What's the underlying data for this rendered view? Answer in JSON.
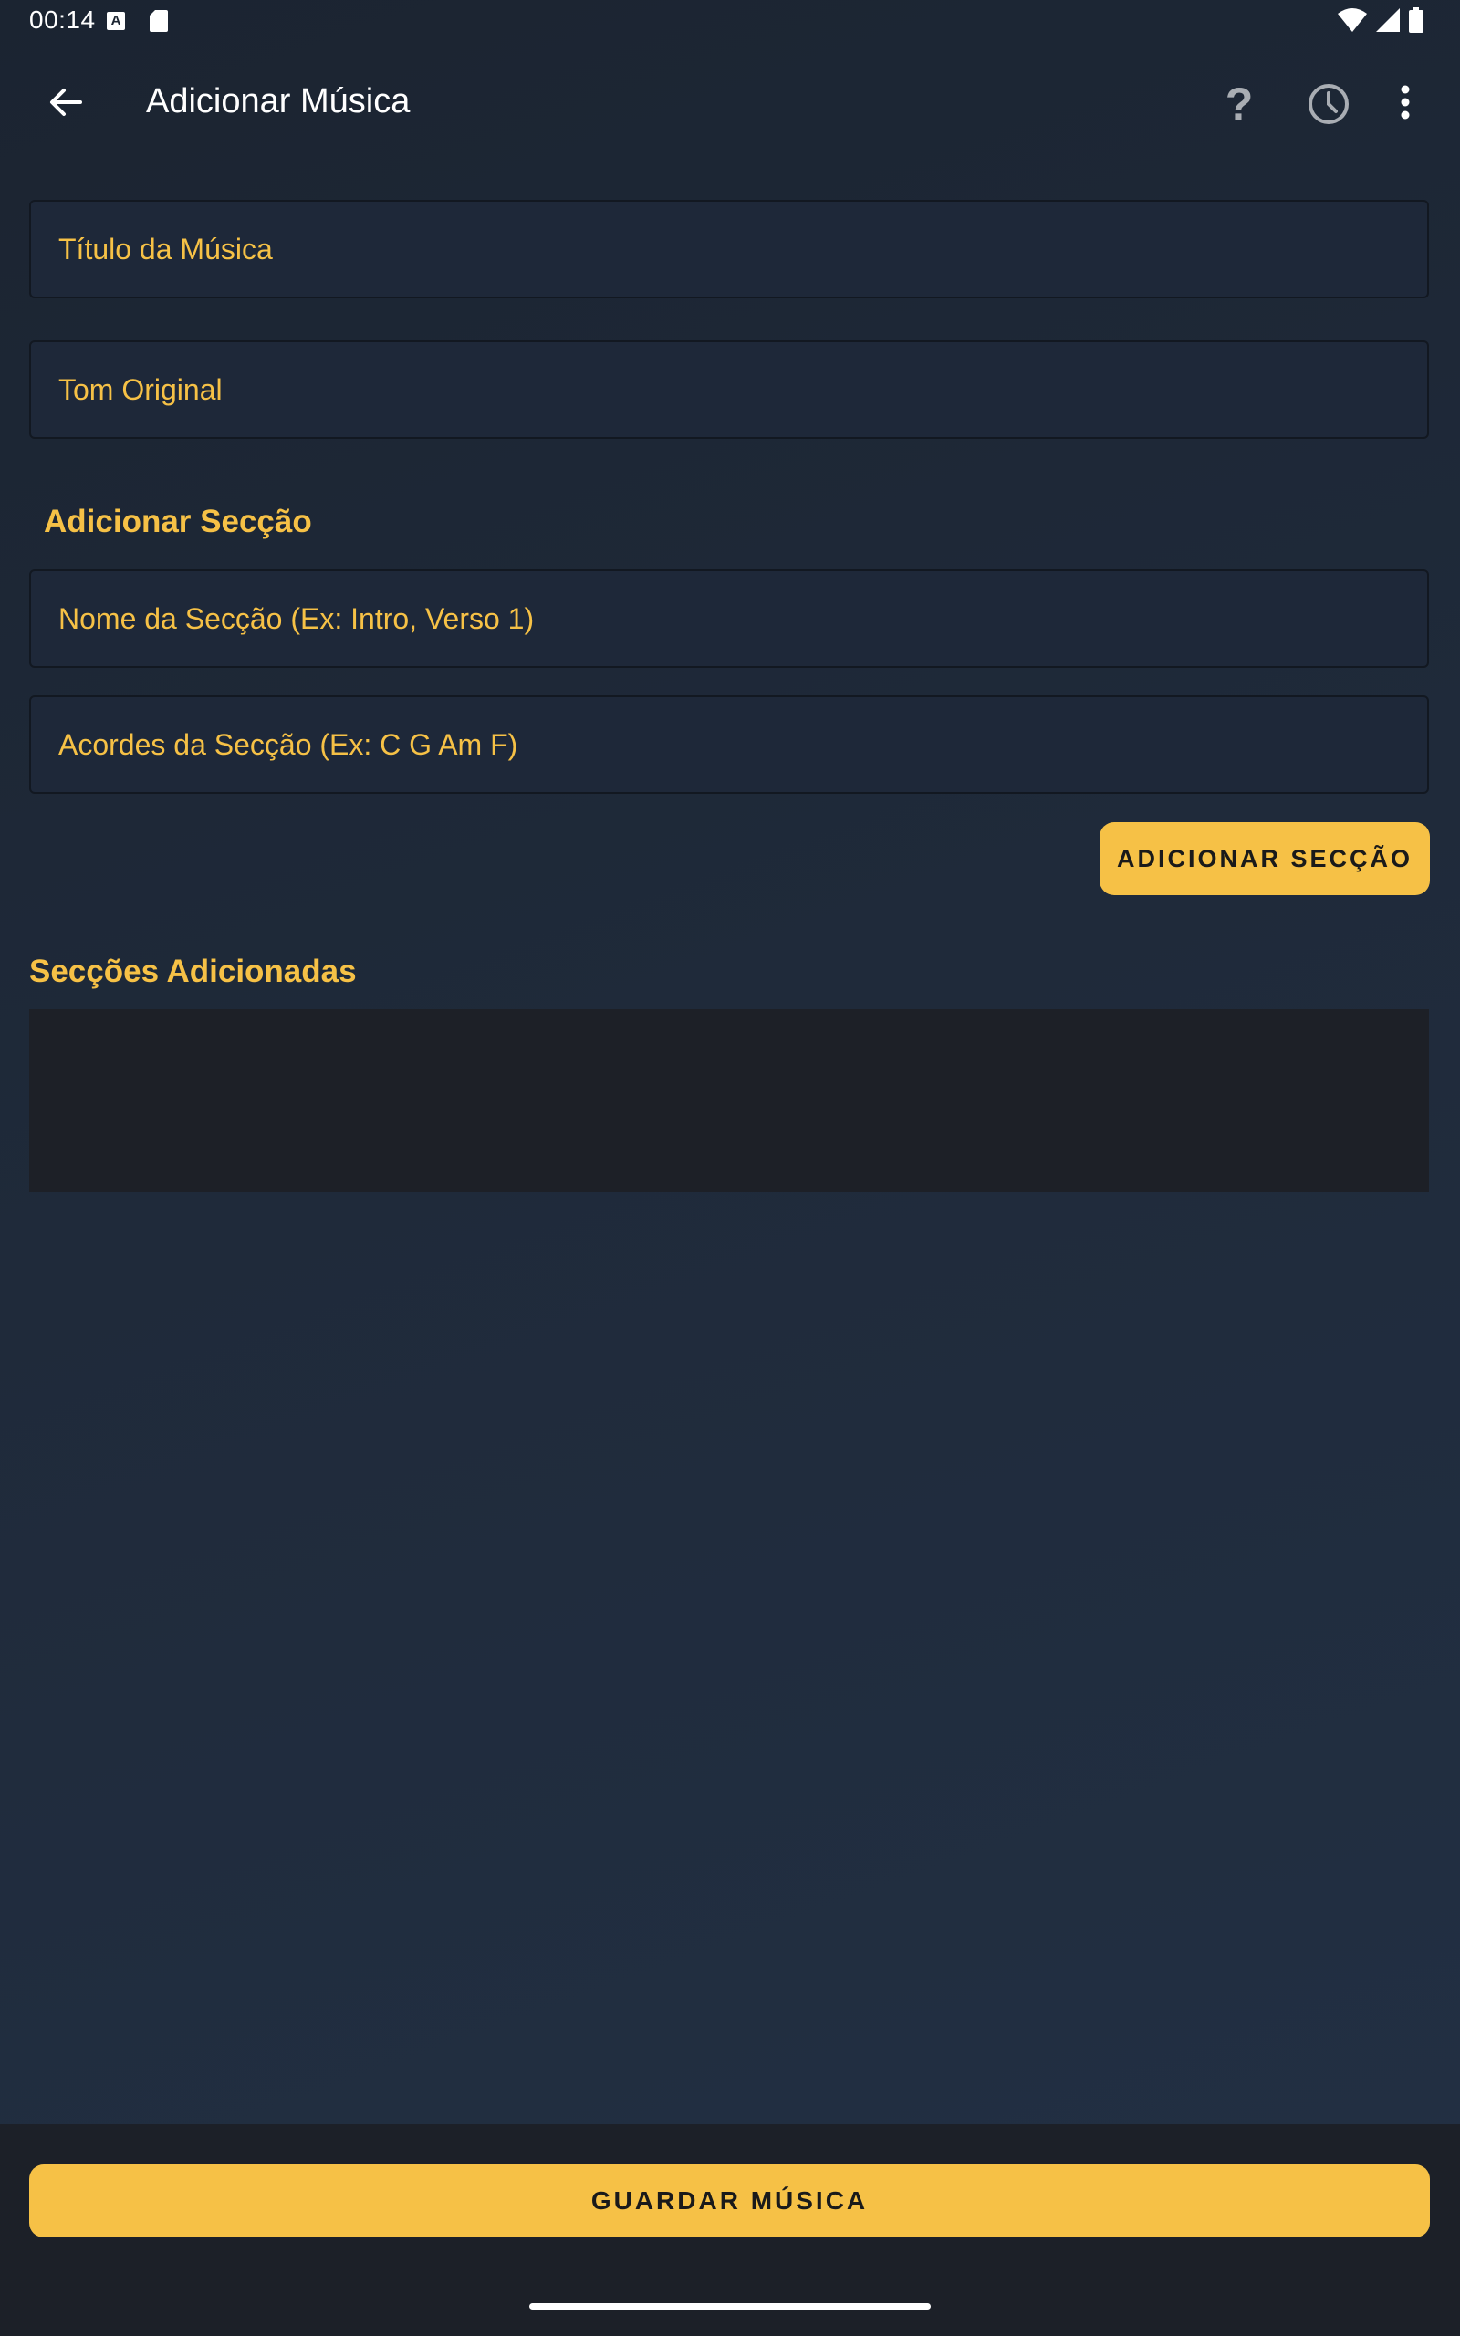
{
  "status_bar": {
    "time": "00:14",
    "notification_icon_letter": "A"
  },
  "app_bar": {
    "title": "Adicionar Música",
    "help_glyph": "?"
  },
  "form": {
    "title_placeholder": "Título da Música",
    "key_placeholder": "Tom Original",
    "add_section_heading": "Adicionar Secção",
    "section_name_placeholder": "Nome da Secção (Ex: Intro, Verso 1)",
    "section_chords_placeholder": "Acordes da Secção (Ex: C G Am F)",
    "add_section_button": "ADICIONAR SECÇÃO",
    "added_sections_heading": "Secções Adicionadas"
  },
  "footer": {
    "save_button": "GUARDAR MÚSICA"
  },
  "colors": {
    "accent": "#f6c146",
    "background": "#1f2a3a",
    "field_background": "#1e2839",
    "list_background": "#1d2027",
    "bottom_bar": "#1c2028"
  },
  "icons": [
    "back-arrow-icon",
    "help-icon",
    "history-icon",
    "more-vert-icon",
    "wifi-icon",
    "signal-icon",
    "battery-icon",
    "sd-card-icon"
  ]
}
